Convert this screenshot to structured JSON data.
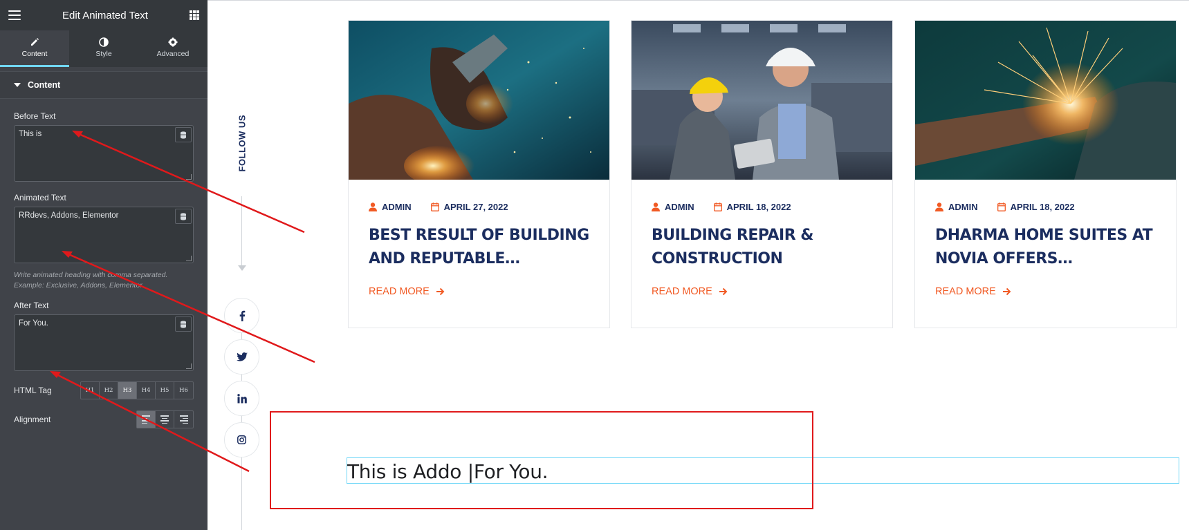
{
  "panel": {
    "title": "Edit Animated Text",
    "tabs": [
      {
        "label": "Content",
        "icon": "pencil-icon"
      },
      {
        "label": "Style",
        "icon": "contrast-icon"
      },
      {
        "label": "Advanced",
        "icon": "gear-icon"
      }
    ],
    "section": "Content",
    "before_text": {
      "label": "Before Text",
      "value": "This is"
    },
    "animated_text": {
      "label": "Animated Text",
      "value": "RRdevs, Addons, Elementor",
      "help_line1": "Write animated heading with comma separated.",
      "help_line2": "Example: Exclusive, Addons, Elementor"
    },
    "after_text": {
      "label": "After Text",
      "value": "For You."
    },
    "html_tag": {
      "label": "HTML Tag",
      "options": [
        "H1",
        "H2",
        "H3",
        "H4",
        "H5",
        "H6"
      ],
      "selected": "H3"
    },
    "alignment": {
      "label": "Alignment",
      "selected": "left"
    }
  },
  "preview": {
    "follow_us": "FOLLOW US",
    "social": [
      "facebook-icon",
      "twitter-icon",
      "linkedin-icon",
      "instagram-icon"
    ],
    "cards": [
      {
        "author": "ADMIN",
        "date": "APRIL 27, 2022",
        "title": "BEST RESULT OF BUILDING AND REPUTABLE…",
        "read_more": "READ MORE"
      },
      {
        "author": "ADMIN",
        "date": "APRIL 18, 2022",
        "title": "BUILDING REPAIR & CONSTRUCTION",
        "read_more": "READ MORE"
      },
      {
        "author": "ADMIN",
        "date": "APRIL 18, 2022",
        "title": "DHARMA HOME SUITES AT NOVIA OFFERS…",
        "read_more": "READ MORE"
      }
    ],
    "animated_heading": "This is Addo |For You."
  },
  "colors": {
    "panel_bg": "#404349",
    "accent": "#71d7f7",
    "brand_navy": "#1b2d5f",
    "brand_orange": "#f15a24",
    "annotation_red": "#e0191b"
  }
}
